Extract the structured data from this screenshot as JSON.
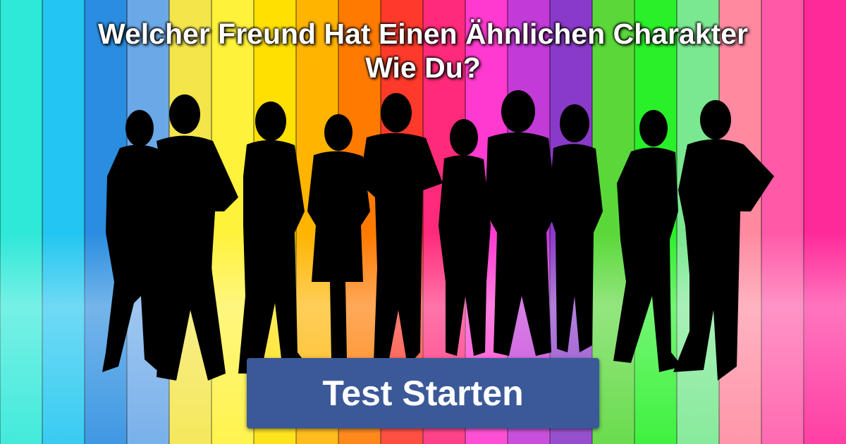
{
  "title": {
    "line1": "Welcher Freund Hat Einen Ähnlichen Charakter",
    "line2": "Wie Du?"
  },
  "start_button": {
    "label": "Test Starten"
  },
  "colors": {
    "button_bg": "#3b5998",
    "stripes": [
      "#2ee8d8",
      "#22c6f0",
      "#2a8de0",
      "#6aa8e8",
      "#f4e54a",
      "#fff23a",
      "#ffe000",
      "#ffb400",
      "#ff7a00",
      "#ff3a2a",
      "#ff2a7a",
      "#ff3ad0",
      "#c23ad8",
      "#8a3ac8",
      "#5ad83a",
      "#2af02a",
      "#7ae890",
      "#ff8aa0",
      "#ff5aa8",
      "#ff2a9a"
    ],
    "silhouette": "#000000"
  }
}
